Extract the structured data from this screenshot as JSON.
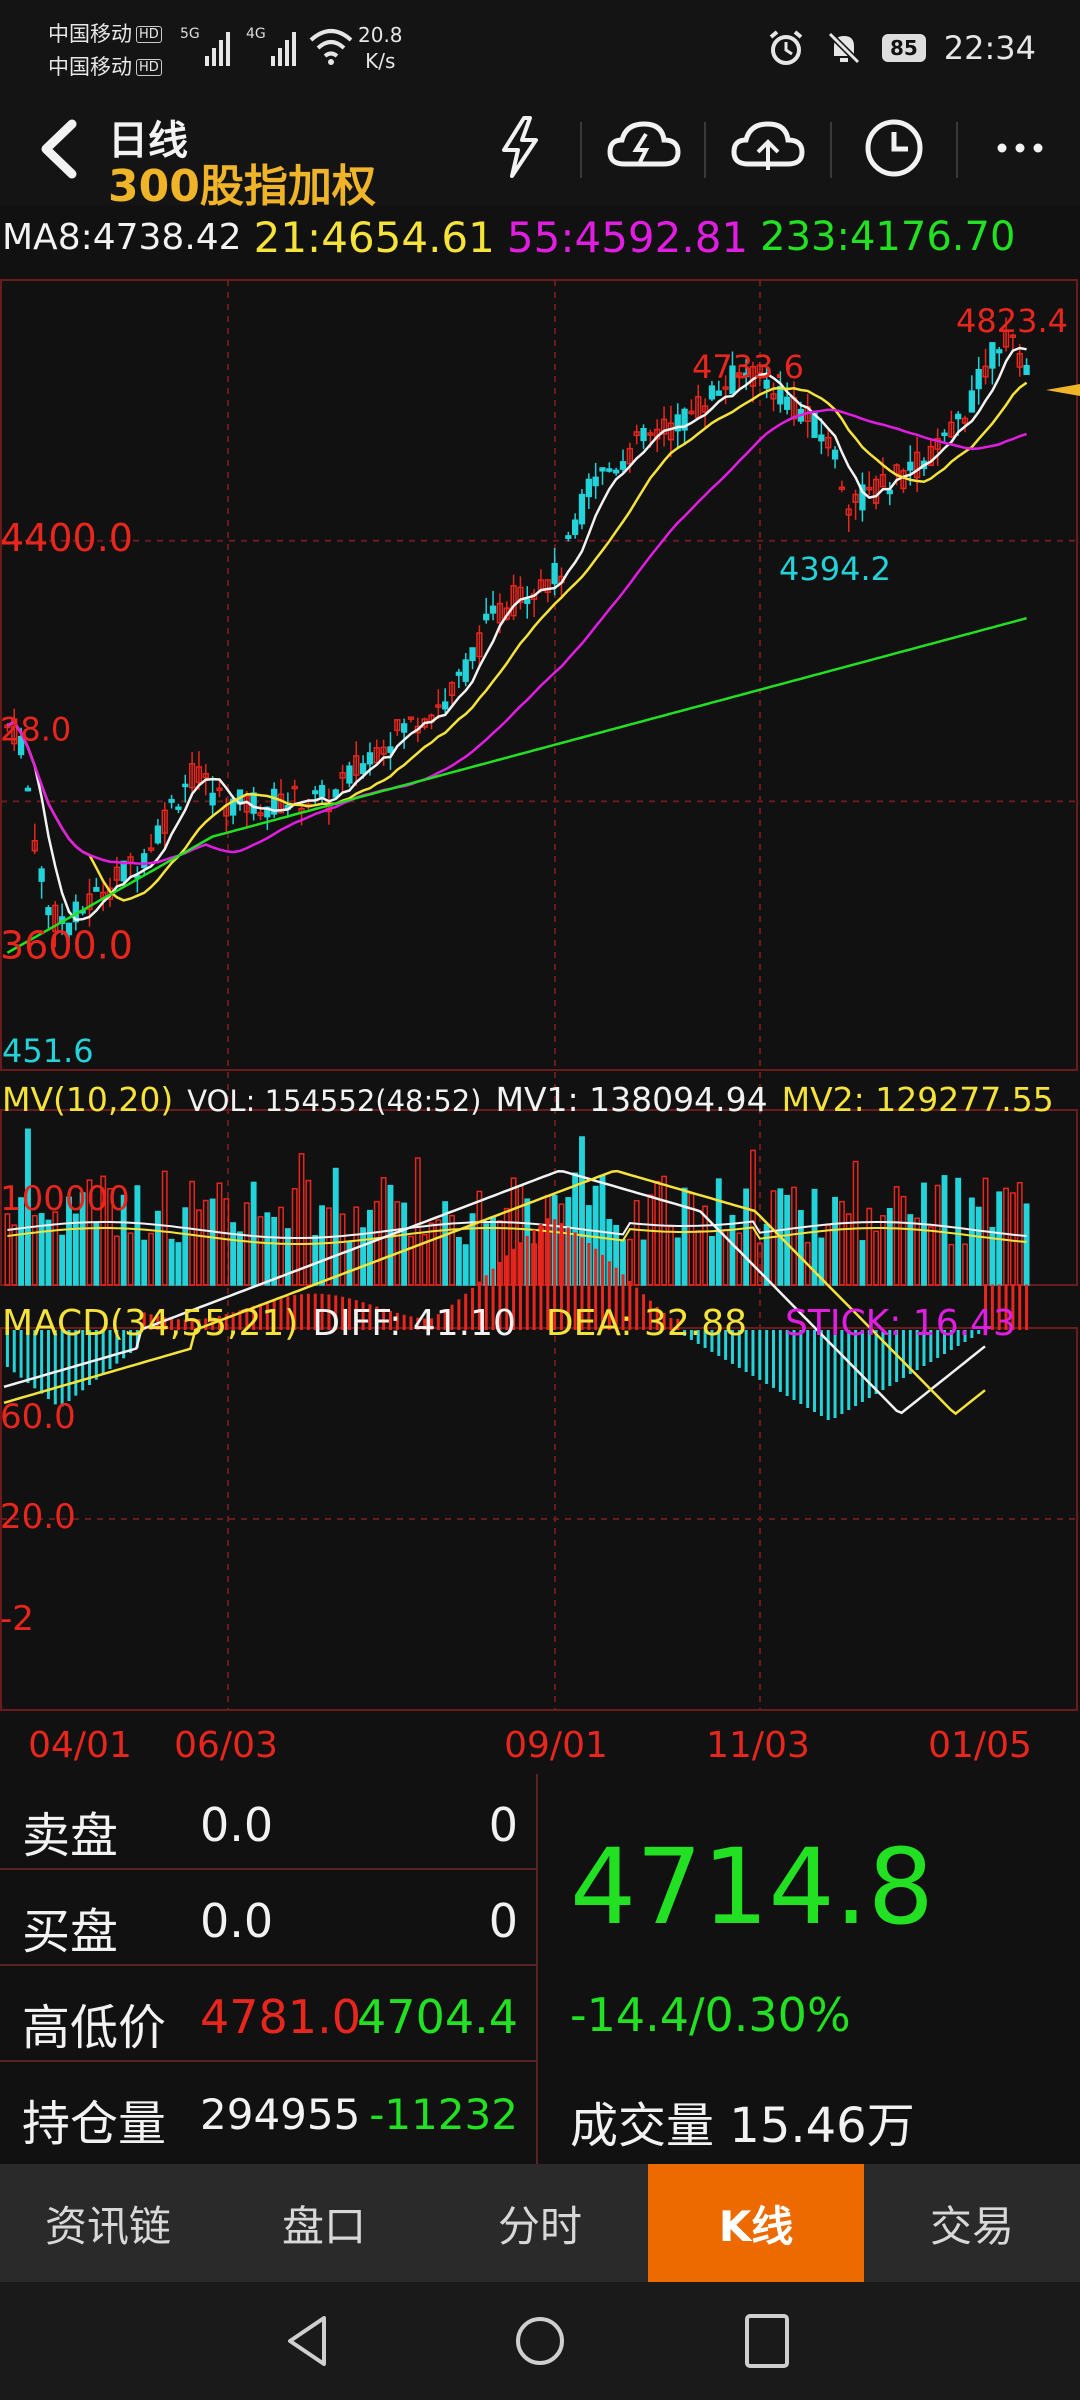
{
  "status_bar": {
    "carrier1": "中国移动",
    "carrier2": "中国移动",
    "hd": "HD",
    "sig1_label": "5G",
    "sig2_label": "4G",
    "net_speed": "20.8",
    "net_unit": "K/s",
    "battery": "85",
    "time": "22:34"
  },
  "header": {
    "period": "日线",
    "instrument": "300股指加权"
  },
  "ma": {
    "ma8": "MA8:4738.42",
    "ma21": "21:4654.61",
    "ma55": "55:4592.81",
    "ma233": "233:4176.70"
  },
  "price_chart": {
    "y_labels": [
      {
        "text": "4400.0",
        "price": 4400
      },
      {
        "text": "28.0",
        "price": 4028
      },
      {
        "text": "3600.0",
        "price": 3600
      }
    ],
    "high_label": "4823.4",
    "peak_label": "4733.6",
    "trough_label": "4394.2",
    "low_label": "451.6"
  },
  "volume": {
    "title": "MV(10,20)",
    "vol": "VOL: 154552(48:52)",
    "mv1": "MV1: 138094.94",
    "mv2": "MV2: 129277.55",
    "y_label": "100000"
  },
  "macd": {
    "title": "MACD(34,55,21)",
    "diff": "DIFF: 41.10",
    "dea": "DEA: 32.88",
    "stick": "STICK: 16.43",
    "y_labels": [
      "60.0",
      "20.0",
      "-2"
    ]
  },
  "dates": [
    "04/01",
    "06/03",
    "09/01",
    "11/03",
    "01/05"
  ],
  "quote": {
    "sell_label": "卖盘",
    "sell_price": "0.0",
    "sell_qty": "0",
    "buy_label": "买盘",
    "buy_price": "0.0",
    "buy_qty": "0",
    "hl_label": "高低价",
    "high": "4781.0",
    "low": "4704.4",
    "oi_label": "持仓量",
    "oi": "294955",
    "oi_change": "-11232",
    "last": "4714.8",
    "change": "-14.4/0.30%",
    "turnover_label": "成交量",
    "turnover": "15.46万"
  },
  "tabs": [
    "资讯链",
    "盘口",
    "分时",
    "K线",
    "交易"
  ],
  "active_tab": 3,
  "colors": {
    "up": "#e8261d",
    "down": "#22d3d9",
    "green": "#22e022",
    "gold": "#f0b429",
    "magenta": "#e21de2",
    "yellow": "#f5e33a",
    "grid": "#6a1b1b",
    "active_tab": "#ec6a00"
  }
}
